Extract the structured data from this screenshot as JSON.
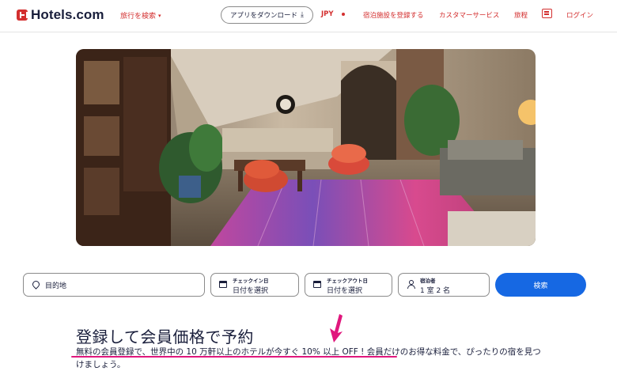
{
  "header": {
    "logo_text": "Hotels.com",
    "trip_menu_label": "旅行を検索",
    "app_download_label": "アプリをダウンロード",
    "currency_label": "JPY",
    "list_property_label": "宿泊施設を登録する",
    "customer_service_label": "カスタマーサービス",
    "trips_label": "旅程",
    "login_label": "ログイン"
  },
  "search": {
    "destination_placeholder": "目的地",
    "checkin_label": "チェックイン日",
    "checkin_value": "日付を選択",
    "checkout_label": "チェックアウト日",
    "checkout_value": "日付を選択",
    "travelers_label": "宿泊者",
    "travelers_value": "1 室 2 名",
    "search_button_label": "検索"
  },
  "promo": {
    "title": "登録して会員価格で予約",
    "body": "無料の会員登録で、世界中の 10 万軒以上のホテルが今すぐ 10% 以上 OFF ! 会員だけのお得な料金で、ぴったりの宿を見つけましょう。"
  },
  "colors": {
    "brand_red": "#d32f2f",
    "search_blue": "#1668e3",
    "annotation_magenta": "#e0177d",
    "text_dark": "#191e3b"
  },
  "icons": {
    "logo": "hotels-logo-icon",
    "chevron": "chevron-down-icon",
    "download": "download-icon",
    "chat": "chat-icon",
    "destination": "map-pin-icon",
    "calendar": "calendar-icon",
    "travelers": "person-icon"
  }
}
